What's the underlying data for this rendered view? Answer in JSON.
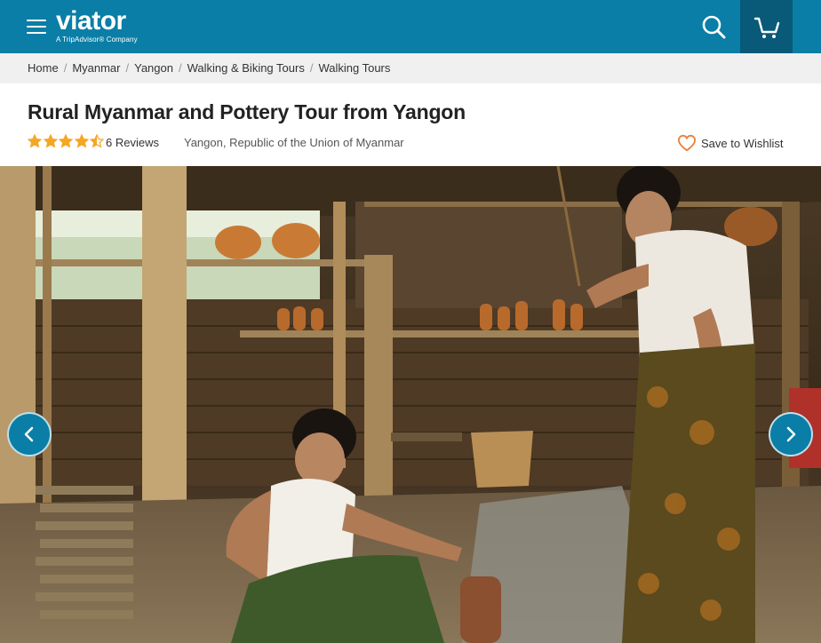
{
  "header": {
    "logo_text": "viator",
    "logo_subtitle": "A TripAdvisor® Company",
    "brand_color": "#0a7ea6",
    "cart_bg_color": "#085a78",
    "menu_icon": "hamburger-menu-icon",
    "search_icon": "search-icon",
    "cart_icon": "shopping-cart-icon"
  },
  "breadcrumb": {
    "items": [
      {
        "label": "Home"
      },
      {
        "label": "Myanmar"
      },
      {
        "label": "Yangon"
      },
      {
        "label": "Walking & Biking Tours"
      },
      {
        "label": "Walking Tours"
      }
    ]
  },
  "product": {
    "title": "Rural Myanmar and Pottery Tour from Yangon",
    "rating": 4.5,
    "rating_max": 5,
    "star_color": "#f5a623",
    "reviews_label": "6 Reviews",
    "location": "Yangon, Republic of the Union of Myanmar",
    "wishlist_label": "Save to Wishlist",
    "wishlist_icon": "heart-outline-icon",
    "wishlist_color": "#e8813a"
  },
  "gallery": {
    "image_subject": "pottery-workshop-photo",
    "prev_icon": "chevron-left-icon",
    "next_icon": "chevron-right-icon"
  }
}
